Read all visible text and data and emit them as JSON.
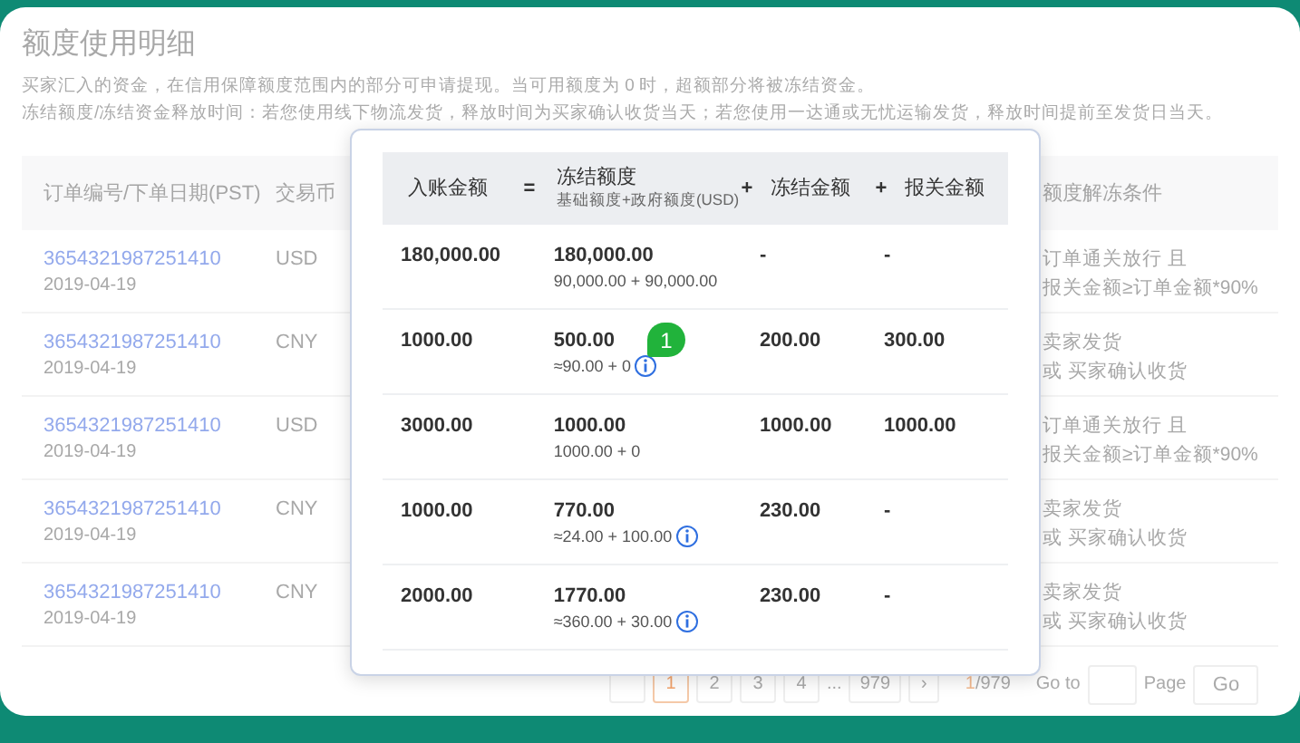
{
  "page": {
    "title": "额度使用明细",
    "notes": [
      "买家汇入的资金，在信用保障额度范围内的部分可申请提现。当可用额度为 0 时，超额部分将被冻结资金。",
      "冻结额度/冻结资金释放时间：若您使用线下物流发货，释放时间为买家确认收货当天；若您使用一达通或无忧运输发货，释放时间提前至发货日当天。"
    ],
    "columns": [
      "订单编号/下单日期(PST)",
      "交易币",
      "额度解冻条件"
    ],
    "rows": [
      {
        "order_id": "3654321987251410",
        "date": "2019-04-19",
        "currency": "USD",
        "condition": [
          "订单通关放行 且",
          "报关金额≥订单金额*90%"
        ]
      },
      {
        "order_id": "3654321987251410",
        "date": "2019-04-19",
        "currency": "CNY",
        "condition": [
          "卖家发货",
          "或 买家确认收货"
        ]
      },
      {
        "order_id": "3654321987251410",
        "date": "2019-04-19",
        "currency": "USD",
        "condition": [
          "订单通关放行 且",
          "报关金额≥订单金额*90%"
        ]
      },
      {
        "order_id": "3654321987251410",
        "date": "2019-04-19",
        "currency": "CNY",
        "condition": [
          "卖家发货",
          "或 买家确认收货"
        ]
      },
      {
        "order_id": "3654321987251410",
        "date": "2019-04-19",
        "currency": "CNY",
        "condition": [
          "卖家发货",
          "或 买家确认收货"
        ]
      }
    ],
    "pagination": {
      "pages": [
        {
          "label": "1",
          "selected": true
        },
        {
          "label": "2",
          "selected": false
        },
        {
          "label": "3",
          "selected": false
        },
        {
          "label": "4",
          "selected": false
        },
        {
          "kind": "ellipsis",
          "label": "...",
          "selected": false
        },
        {
          "label": "979",
          "selected": false
        }
      ],
      "next": "›",
      "current": "1",
      "total": "/979",
      "goto_label": "Go to",
      "page_label": "Page",
      "go_button": "Go"
    }
  },
  "popup": {
    "header": [
      {
        "kind": "column",
        "label": "入账金额"
      },
      {
        "kind": "operator",
        "label": "="
      },
      {
        "kind": "column",
        "label": "冻结额度",
        "sublabel": "基础额度+政府额度(USD)"
      },
      {
        "kind": "operator",
        "label": "+"
      },
      {
        "kind": "column",
        "label": "冻结金额"
      },
      {
        "kind": "operator",
        "label": "+"
      },
      {
        "kind": "column",
        "label": "报关金额"
      }
    ],
    "rows": [
      {
        "incoming": "180,000.00",
        "frozen_quota": "180,000.00",
        "breakdown": "90,000.00 + 90,000.00",
        "info": false,
        "frozen_amount": "-",
        "customs_amount": "-"
      },
      {
        "incoming": "1000.00",
        "frozen_quota": "500.00",
        "breakdown": "≈90.00 + 0",
        "info": true,
        "frozen_amount": "200.00",
        "customs_amount": "300.00"
      },
      {
        "incoming": "3000.00",
        "frozen_quota": "1000.00",
        "breakdown": "1000.00 + 0",
        "info": false,
        "frozen_amount": "1000.00",
        "customs_amount": "1000.00"
      },
      {
        "incoming": "1000.00",
        "frozen_quota": "770.00",
        "breakdown": "≈24.00 + 100.00",
        "info": true,
        "frozen_amount": "230.00",
        "customs_amount": "-"
      },
      {
        "incoming": "2000.00",
        "frozen_quota": "1770.00",
        "breakdown": "≈360.00 + 30.00",
        "info": true,
        "frozen_amount": "230.00",
        "customs_amount": "-"
      }
    ],
    "badge": "1"
  }
}
